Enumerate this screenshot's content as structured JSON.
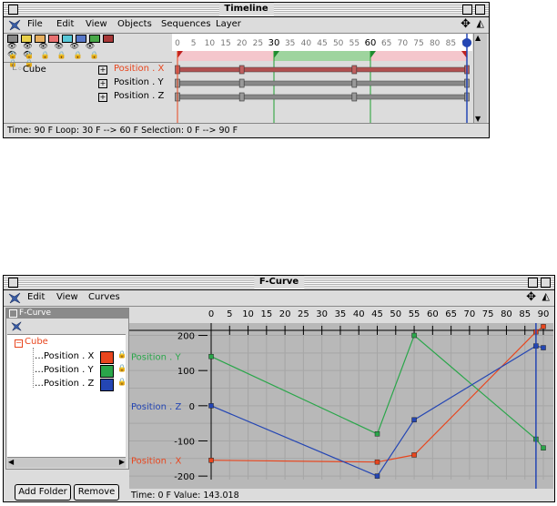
{
  "timeline": {
    "title": "Timeline",
    "menu": [
      "File",
      "Edit",
      "View",
      "Objects",
      "Sequences",
      "Layer"
    ],
    "object": "Cube",
    "tracks": [
      "Position . X",
      "Position . Y",
      "Position . Z"
    ],
    "ruler_ticks": [
      "0",
      "5",
      "10",
      "15",
      "20",
      "25",
      "30",
      "35",
      "40",
      "45",
      "50",
      "55",
      "60",
      "65",
      "70",
      "75",
      "80",
      "85",
      "90"
    ],
    "loop_start": 30,
    "loop_end": 60,
    "current_frame": 90,
    "keyframes": [
      0,
      20,
      55,
      90
    ],
    "status": "Time: 90 F   Loop: 30 F --> 60 F   Selection: 0 F --> 90 F"
  },
  "fcurve": {
    "title": "F-Curve",
    "menu": [
      "Edit",
      "View",
      "Curves"
    ],
    "panel_title": "F-Curve",
    "object": "Cube",
    "curves": [
      {
        "name": "Position . X",
        "color": "#e8461e"
      },
      {
        "name": "Position . Y",
        "color": "#2aa64a"
      },
      {
        "name": "Position . Z",
        "color": "#2446b4"
      }
    ],
    "x_ticks": [
      "0",
      "5",
      "10",
      "15",
      "20",
      "25",
      "30",
      "35",
      "40",
      "45",
      "50",
      "55",
      "60",
      "65",
      "70",
      "75",
      "80",
      "85",
      "90"
    ],
    "y_ticks": [
      "200",
      "100",
      "0",
      "-100",
      "-200"
    ],
    "add_folder_label": "Add Folder",
    "remove_label": "Remove",
    "status": "Time: 0 F  Value: 143.018"
  },
  "chart_data": {
    "type": "line",
    "xlim": [
      0,
      90
    ],
    "ylim": [
      -210,
      235
    ],
    "xlabel": "",
    "ylabel": "",
    "series": [
      {
        "name": "Position . X",
        "x": [
          0,
          45,
          55,
          88,
          90
        ],
        "y": [
          -155,
          -160,
          -140,
          210,
          225
        ]
      },
      {
        "name": "Position . Y",
        "x": [
          0,
          45,
          55,
          88,
          90
        ],
        "y": [
          140,
          -80,
          200,
          -95,
          -120
        ]
      },
      {
        "name": "Position . Z",
        "x": [
          0,
          45,
          55,
          88,
          90
        ],
        "y": [
          0,
          -200,
          -40,
          170,
          165
        ]
      }
    ]
  }
}
